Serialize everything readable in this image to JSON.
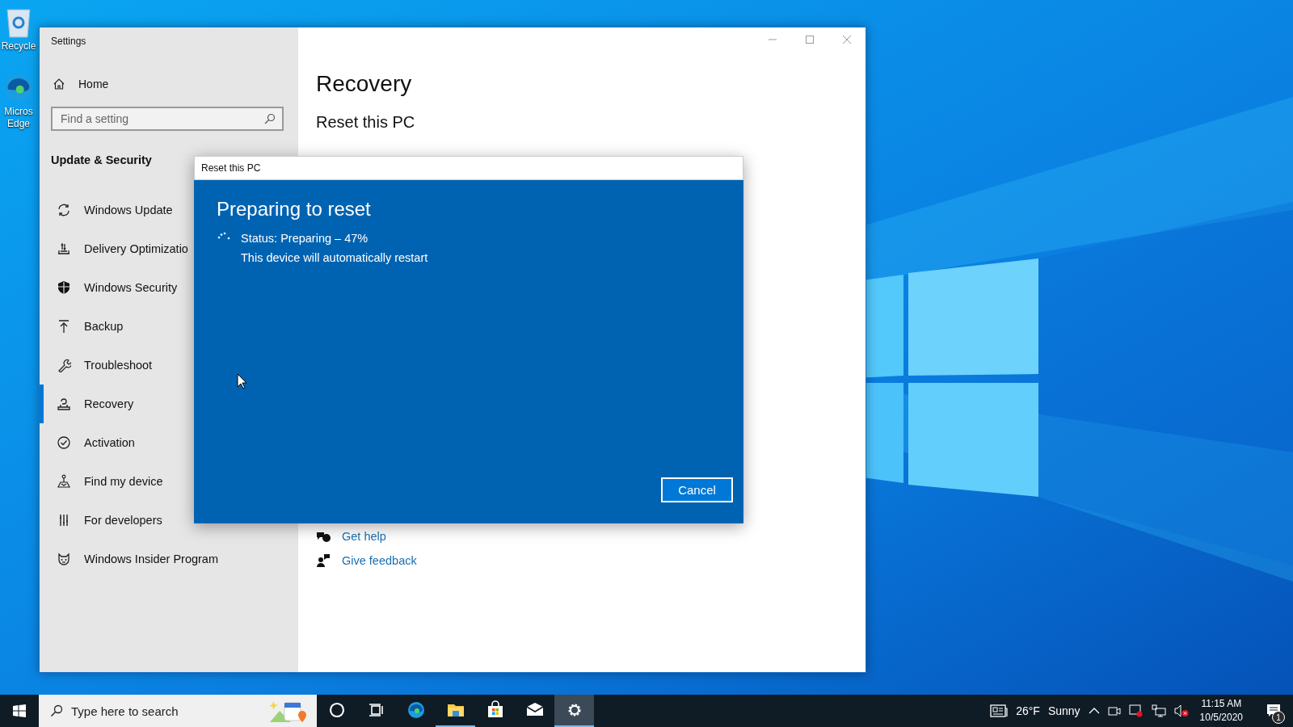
{
  "desktop_icons": [
    {
      "kind": "recycle-bin",
      "label": "Recycle"
    },
    {
      "kind": "edge",
      "label": "Micros Edge"
    }
  ],
  "settings_window": {
    "title": "Settings",
    "sidebar": {
      "home": "Home",
      "search": {
        "placeholder": "Find a setting"
      },
      "section": "Update & Security",
      "items": [
        {
          "kind": "update",
          "label": "Windows Update",
          "selected": false
        },
        {
          "kind": "delivery",
          "label": "Delivery Optimizatio",
          "selected": false
        },
        {
          "kind": "shield",
          "label": "Windows Security",
          "selected": false
        },
        {
          "kind": "backup",
          "label": "Backup",
          "selected": false
        },
        {
          "kind": "wrench",
          "label": "Troubleshoot",
          "selected": false
        },
        {
          "kind": "recovery",
          "label": "Recovery",
          "selected": true
        },
        {
          "kind": "activation",
          "label": "Activation",
          "selected": false
        },
        {
          "kind": "find",
          "label": "Find my device",
          "selected": false
        },
        {
          "kind": "developers",
          "label": "For developers",
          "selected": false
        },
        {
          "kind": "insider",
          "label": "Windows Insider Program",
          "selected": false
        }
      ]
    },
    "content": {
      "heading": "Recovery",
      "subheading": "Reset this PC",
      "links": [
        {
          "kind": "help",
          "label": "Get help"
        },
        {
          "kind": "feedback",
          "label": "Give feedback"
        }
      ]
    }
  },
  "dialog": {
    "title": "Reset this PC",
    "heading": "Preparing to reset",
    "status": "Status: Preparing – 47%",
    "note": "This device will automatically restart",
    "button": "Cancel"
  },
  "taskbar": {
    "search": {
      "placeholder": "Type here to search"
    },
    "apps": [
      {
        "kind": "cortana",
        "running": false,
        "selected": false
      },
      {
        "kind": "task-view",
        "running": false,
        "selected": false
      },
      {
        "kind": "edge",
        "running": false,
        "selected": false
      },
      {
        "kind": "explorer",
        "running": true,
        "selected": false
      },
      {
        "kind": "store",
        "running": false,
        "selected": false
      },
      {
        "kind": "mail",
        "running": false,
        "selected": false
      },
      {
        "kind": "settings",
        "running": true,
        "selected": true
      }
    ],
    "weather": {
      "temperature": "26°F",
      "condition": "Sunny"
    },
    "clock": {
      "time": "11:15 AM",
      "date": "10/5/2020"
    },
    "notifications": {
      "count": "1"
    }
  }
}
